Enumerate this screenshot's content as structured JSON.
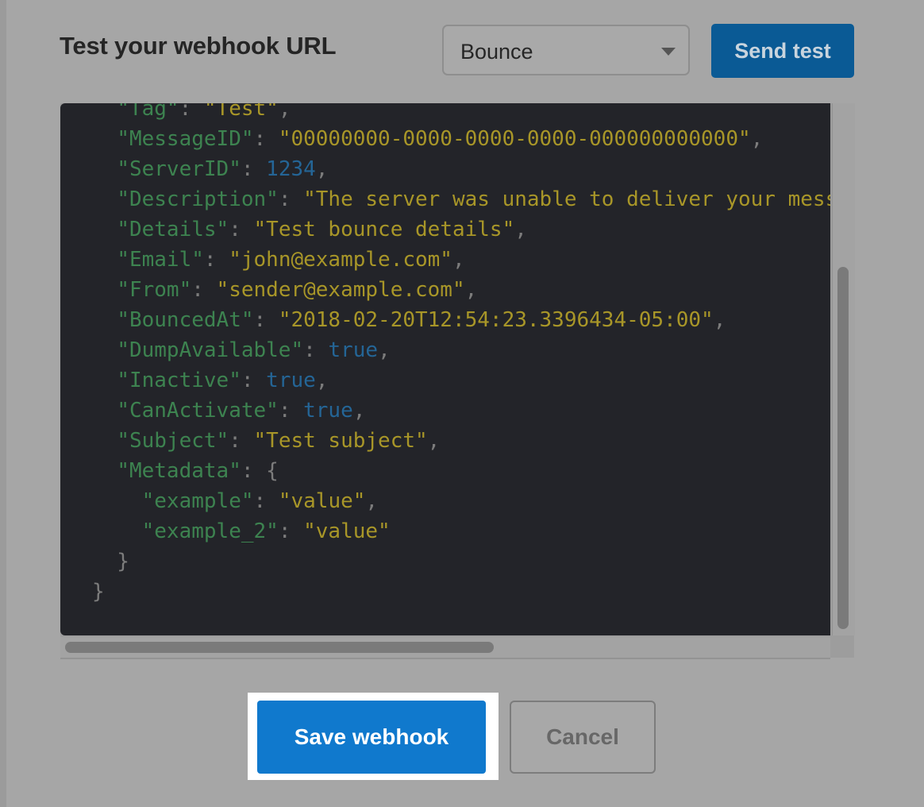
{
  "header": {
    "title": "Test your webhook URL",
    "event_select": {
      "selected": "Bounce"
    },
    "send_test_label": "Send test"
  },
  "code": {
    "lines": [
      [
        {
          "t": "  ",
          "c": "p"
        },
        {
          "t": "\"Tag\"",
          "c": "k"
        },
        {
          "t": ": ",
          "c": "p"
        },
        {
          "t": "\"Test\"",
          "c": "s"
        },
        {
          "t": ",",
          "c": "p"
        }
      ],
      [
        {
          "t": "  ",
          "c": "p"
        },
        {
          "t": "\"MessageID\"",
          "c": "k"
        },
        {
          "t": ": ",
          "c": "p"
        },
        {
          "t": "\"00000000-0000-0000-0000-000000000000\"",
          "c": "s"
        },
        {
          "t": ",",
          "c": "p"
        }
      ],
      [
        {
          "t": "  ",
          "c": "p"
        },
        {
          "t": "\"ServerID\"",
          "c": "k"
        },
        {
          "t": ": ",
          "c": "p"
        },
        {
          "t": "1234",
          "c": "n"
        },
        {
          "t": ",",
          "c": "p"
        }
      ],
      [
        {
          "t": "  ",
          "c": "p"
        },
        {
          "t": "\"Description\"",
          "c": "k"
        },
        {
          "t": ": ",
          "c": "p"
        },
        {
          "t": "\"The server was unable to deliver your mess",
          "c": "s"
        }
      ],
      [
        {
          "t": "  ",
          "c": "p"
        },
        {
          "t": "\"Details\"",
          "c": "k"
        },
        {
          "t": ": ",
          "c": "p"
        },
        {
          "t": "\"Test bounce details\"",
          "c": "s"
        },
        {
          "t": ",",
          "c": "p"
        }
      ],
      [
        {
          "t": "  ",
          "c": "p"
        },
        {
          "t": "\"Email\"",
          "c": "k"
        },
        {
          "t": ": ",
          "c": "p"
        },
        {
          "t": "\"john@example.com\"",
          "c": "s"
        },
        {
          "t": ",",
          "c": "p"
        }
      ],
      [
        {
          "t": "  ",
          "c": "p"
        },
        {
          "t": "\"From\"",
          "c": "k"
        },
        {
          "t": ": ",
          "c": "p"
        },
        {
          "t": "\"sender@example.com\"",
          "c": "s"
        },
        {
          "t": ",",
          "c": "p"
        }
      ],
      [
        {
          "t": "  ",
          "c": "p"
        },
        {
          "t": "\"BouncedAt\"",
          "c": "k"
        },
        {
          "t": ": ",
          "c": "p"
        },
        {
          "t": "\"2018-02-20T12:54:23.3396434-05:00\"",
          "c": "s"
        },
        {
          "t": ",",
          "c": "p"
        }
      ],
      [
        {
          "t": "  ",
          "c": "p"
        },
        {
          "t": "\"DumpAvailable\"",
          "c": "k"
        },
        {
          "t": ": ",
          "c": "p"
        },
        {
          "t": "true",
          "c": "n"
        },
        {
          "t": ",",
          "c": "p"
        }
      ],
      [
        {
          "t": "  ",
          "c": "p"
        },
        {
          "t": "\"Inactive\"",
          "c": "k"
        },
        {
          "t": ": ",
          "c": "p"
        },
        {
          "t": "true",
          "c": "n"
        },
        {
          "t": ",",
          "c": "p"
        }
      ],
      [
        {
          "t": "  ",
          "c": "p"
        },
        {
          "t": "\"CanActivate\"",
          "c": "k"
        },
        {
          "t": ": ",
          "c": "p"
        },
        {
          "t": "true",
          "c": "n"
        },
        {
          "t": ",",
          "c": "p"
        }
      ],
      [
        {
          "t": "  ",
          "c": "p"
        },
        {
          "t": "\"Subject\"",
          "c": "k"
        },
        {
          "t": ": ",
          "c": "p"
        },
        {
          "t": "\"Test subject\"",
          "c": "s"
        },
        {
          "t": ",",
          "c": "p"
        }
      ],
      [
        {
          "t": "  ",
          "c": "p"
        },
        {
          "t": "\"Metadata\"",
          "c": "k"
        },
        {
          "t": ": {",
          "c": "p"
        }
      ],
      [
        {
          "t": "    ",
          "c": "p"
        },
        {
          "t": "\"example\"",
          "c": "k"
        },
        {
          "t": ": ",
          "c": "p"
        },
        {
          "t": "\"value\"",
          "c": "s"
        },
        {
          "t": ",",
          "c": "p"
        }
      ],
      [
        {
          "t": "    ",
          "c": "p"
        },
        {
          "t": "\"example_2\"",
          "c": "k"
        },
        {
          "t": ": ",
          "c": "p"
        },
        {
          "t": "\"value\"",
          "c": "s"
        }
      ],
      [
        {
          "t": "  }",
          "c": "p"
        }
      ],
      [
        {
          "t": "}",
          "c": "p"
        }
      ]
    ]
  },
  "footer": {
    "save_label": "Save webhook",
    "cancel_label": "Cancel"
  },
  "colors": {
    "primary": "#1079cd",
    "send_test": "#0a5a95",
    "code_background": "#232429",
    "json_key": "#3d8350",
    "json_string": "#a89628",
    "json_number": "#246596",
    "highlight": "#ffffff"
  }
}
